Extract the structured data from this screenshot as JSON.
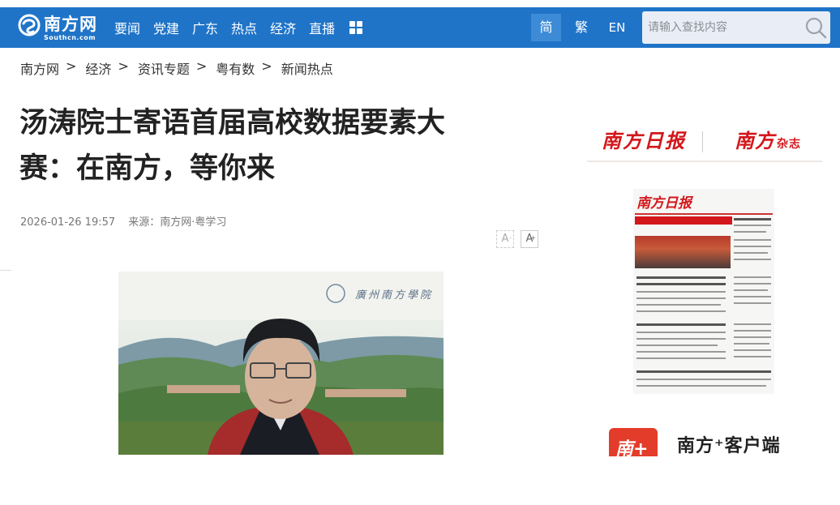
{
  "logo": {
    "text": "南方网",
    "sub": "Southcn.com"
  },
  "nav": {
    "items": [
      "要闻",
      "党建",
      "广东",
      "热点",
      "经济",
      "直播"
    ]
  },
  "lang": {
    "simplified": "简",
    "traditional": "繁",
    "english": "EN"
  },
  "search": {
    "placeholder": "请输入查找内容"
  },
  "breadcrumb": [
    "南方网",
    "经济",
    "资讯专题",
    "粤有数",
    "新闻热点"
  ],
  "breadcrumb_sep": ">",
  "article": {
    "title": "汤涛院士寄语首届高校数据要素大赛：在南方，等你来",
    "date": "2026-01-26 19:57",
    "source": "来源：南方网·粤学习"
  },
  "font_controls": {
    "decrease": "A",
    "increase": "A"
  },
  "sidebar": {
    "paper_a": "南方日报",
    "paper_b": "南方",
    "paper_b_suffix": "杂志",
    "newspaper_head": "南方日报",
    "app_icon": "南+",
    "app_label": "南方⁺客户端"
  },
  "colors": {
    "nav_bg": "#1f74c8",
    "accent_red": "#d3171b"
  }
}
